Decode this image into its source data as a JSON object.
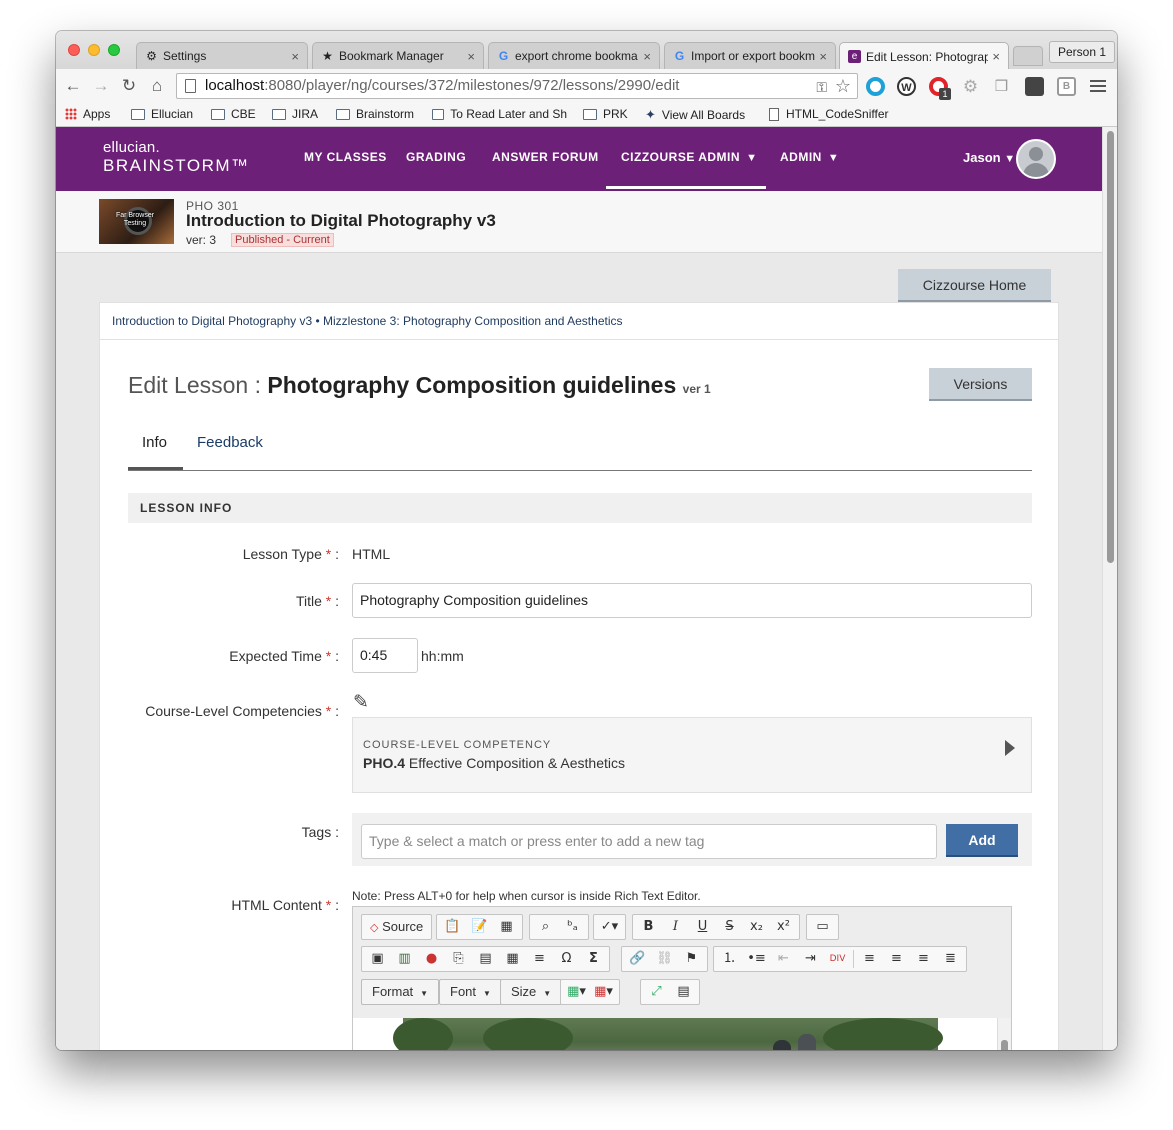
{
  "browser": {
    "tabs": [
      {
        "label": "Settings",
        "icon": "gear-icon"
      },
      {
        "label": "Bookmark Manager",
        "icon": "star-icon"
      },
      {
        "label": "export chrome bookma",
        "icon": "google-icon"
      },
      {
        "label": "Import or export bookm",
        "icon": "google-icon"
      },
      {
        "label": "Edit Lesson: Photograp",
        "icon": "ellucian-icon"
      }
    ],
    "profile": "Person 1",
    "url_host": "localhost",
    "url_path": ":8080/player/ng/courses/372/milestones/972/lessons/2990/edit",
    "bookmarks": [
      "Apps",
      "Ellucian",
      "CBE",
      "JIRA",
      "Brainstorm",
      "To Read Later and Sh",
      "PRK",
      "View All Boards",
      "HTML_CodeSniffer"
    ]
  },
  "app": {
    "logo_line1": "ellucian.",
    "logo_line2": "BRAINSTORM™",
    "nav": [
      "MY CLASSES",
      "GRADING",
      "ANSWER FORUM",
      "CIZZOURSE ADMIN",
      "ADMIN"
    ],
    "user": "Jason",
    "brand_color": "#6d2077"
  },
  "course": {
    "code": "PHO 301",
    "title": "Introduction to Digital Photography v3",
    "version": "ver: 3",
    "status": "Published - Current",
    "thumb_text": "Far Browser Testing",
    "home_button": "Cizzourse Home"
  },
  "lesson": {
    "breadcrumb": "Introduction to Digital Photography v3 • Mizzlestone 3: Photography Composition and Aesthetics",
    "heading_prefix": "Edit Lesson : ",
    "heading_name": "Photography Composition guidelines",
    "heading_ver": "ver 1",
    "versions_button": "Versions",
    "tabs": [
      "Info",
      "Feedback"
    ],
    "section": "LESSON INFO",
    "fields": {
      "lesson_type_label": "Lesson Type",
      "lesson_type_value": "HTML",
      "title_label": "Title",
      "title_value": "Photography Composition guidelines",
      "expected_time_label": "Expected Time",
      "expected_time_value": "0:45",
      "expected_time_unit": "hh:mm",
      "competencies_label": "Course-Level Competencies",
      "competency_kicker": "COURSE-LEVEL COMPETENCY",
      "competency_code": "PHO.4",
      "competency_name": "Effective Composition & Aesthetics",
      "tags_label": "Tags",
      "tags_placeholder": "Type & select a match or press enter to add a new tag",
      "add_button": "Add",
      "html_label": "HTML Content",
      "editor_note": "Note: Press ALT+0 for help when cursor is inside Rich Text Editor."
    },
    "required_mark": " *",
    "label_suffix": " :"
  },
  "editor": {
    "source_label": "Source",
    "format_label": "Format",
    "font_label": "Font",
    "size_label": "Size"
  }
}
